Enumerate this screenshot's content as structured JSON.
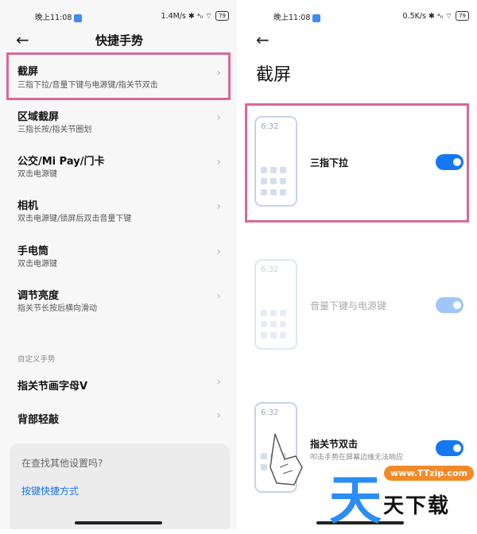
{
  "left": {
    "status": {
      "time": "晚上11:08",
      "right": "1.4M/s ✱ ᵃᵢᵢ ⌔",
      "battery": "79"
    },
    "title": "快捷手势",
    "items": [
      {
        "title": "截屏",
        "sub": "三指下拉/音量下键与电源键/指关节双击"
      },
      {
        "title": "区域截屏",
        "sub": "三指长按/指关节圈划"
      },
      {
        "title": "公交/Mi Pay/门卡",
        "sub": "双击电源键"
      },
      {
        "title": "相机",
        "sub": "双击电源键/锁屏后双击音量下键"
      },
      {
        "title": "手电筒",
        "sub": "双击电源键"
      },
      {
        "title": "调节亮度",
        "sub": "指关节长按后横向滑动"
      }
    ],
    "section": "自定义手势",
    "custom_items": [
      {
        "title": "指关节画字母V"
      },
      {
        "title": "背部轻敲"
      }
    ],
    "help_card": {
      "question": "在查找其他设置吗?",
      "link": "按键快捷方式"
    }
  },
  "right": {
    "status": {
      "time": "晚上11:08",
      "right": "0.5K/s ✱ ᵃᵢᵢ ⌔",
      "battery": "79"
    },
    "title": "截屏",
    "options": [
      {
        "label": "三指下拉",
        "enabled": true,
        "phone_time": "6:32"
      },
      {
        "label": "音量下键与电源键",
        "enabled": false,
        "phone_time": "6:32"
      },
      {
        "label": "指关节双击",
        "sub": "叩击手势在屏幕边缘无法响应",
        "enabled": true,
        "phone_time": "6:32"
      }
    ]
  },
  "watermark": {
    "logo": "天",
    "url": "www.TTzip.com",
    "text": "天下载"
  },
  "colors": {
    "accent": "#1677f3",
    "highlight": "#d9679a",
    "link": "#1677f3"
  }
}
